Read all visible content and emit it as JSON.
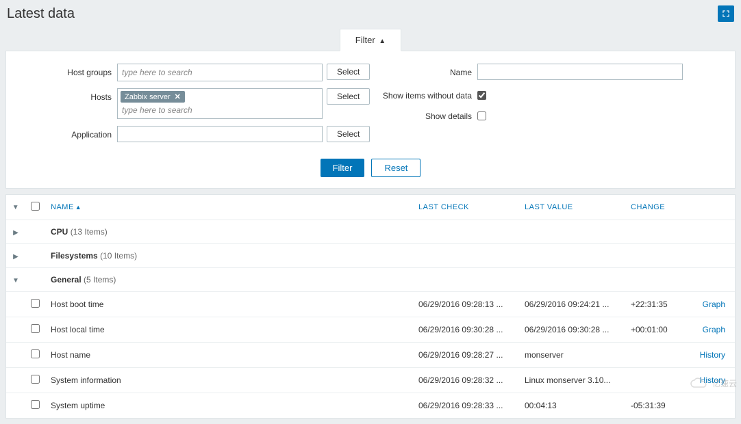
{
  "page": {
    "title": "Latest data"
  },
  "filter": {
    "tab_label": "Filter",
    "host_groups_label": "Host groups",
    "host_groups_placeholder": "type here to search",
    "hosts_label": "Hosts",
    "hosts_tag": "Zabbix server",
    "hosts_placeholder": "type here to search",
    "application_label": "Application",
    "application_value": "",
    "select_btn": "Select",
    "name_label": "Name",
    "name_value": "",
    "show_without_data_label": "Show items without data",
    "show_without_data_checked": true,
    "show_details_label": "Show details",
    "show_details_checked": false,
    "filter_btn": "Filter",
    "reset_btn": "Reset"
  },
  "table": {
    "headers": {
      "name": "Name",
      "last_check": "Last check",
      "last_value": "Last value",
      "change": "Change"
    },
    "groups": [
      {
        "name": "CPU",
        "count_text": "(13 Items)",
        "expanded": false
      },
      {
        "name": "Filesystems",
        "count_text": "(10 Items)",
        "expanded": false
      },
      {
        "name": "General",
        "count_text": "(5 Items)",
        "expanded": true
      }
    ],
    "items": [
      {
        "name": "Host boot time",
        "last_check": "06/29/2016 09:28:13 ...",
        "last_value": "06/29/2016 09:24:21 ...",
        "change": "+22:31:35",
        "action": "Graph"
      },
      {
        "name": "Host local time",
        "last_check": "06/29/2016 09:30:28 ...",
        "last_value": "06/29/2016 09:30:28 ...",
        "change": "+00:01:00",
        "action": "Graph"
      },
      {
        "name": "Host name",
        "last_check": "06/29/2016 09:28:27 ...",
        "last_value": "monserver",
        "change": "",
        "action": "History"
      },
      {
        "name": "System information",
        "last_check": "06/29/2016 09:28:32 ...",
        "last_value": "Linux monserver 3.10...",
        "change": "",
        "action": "History"
      },
      {
        "name": "System uptime",
        "last_check": "06/29/2016 09:28:33 ...",
        "last_value": "00:04:13",
        "change": "-05:31:39",
        "action": ""
      }
    ]
  },
  "watermark": "亿速云"
}
